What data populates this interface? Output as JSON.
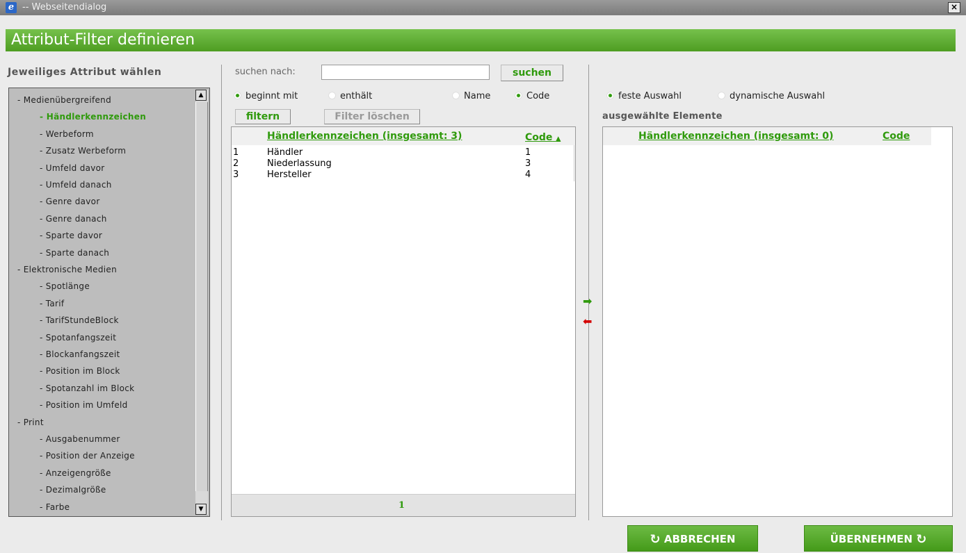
{
  "window": {
    "title": "-- Webseitendialog",
    "close_label": "×"
  },
  "header": {
    "title": "Attribut-Filter definieren"
  },
  "left": {
    "heading": "Jeweiliges Attribut wählen",
    "tree": [
      {
        "label": "Medienübergreifend",
        "level": 0,
        "active": false
      },
      {
        "label": "Händlerkennzeichen",
        "level": 1,
        "active": true
      },
      {
        "label": "Werbeform",
        "level": 1,
        "active": false
      },
      {
        "label": "Zusatz Werbeform",
        "level": 1,
        "active": false
      },
      {
        "label": "Umfeld davor",
        "level": 1,
        "active": false
      },
      {
        "label": "Umfeld danach",
        "level": 1,
        "active": false
      },
      {
        "label": "Genre davor",
        "level": 1,
        "active": false
      },
      {
        "label": "Genre danach",
        "level": 1,
        "active": false
      },
      {
        "label": "Sparte davor",
        "level": 1,
        "active": false
      },
      {
        "label": "Sparte danach",
        "level": 1,
        "active": false
      },
      {
        "label": "Elektronische Medien",
        "level": 0,
        "active": false
      },
      {
        "label": "Spotlänge",
        "level": 1,
        "active": false
      },
      {
        "label": "Tarif",
        "level": 1,
        "active": false
      },
      {
        "label": "TarifStundeBlock",
        "level": 1,
        "active": false
      },
      {
        "label": "Spotanfangszeit",
        "level": 1,
        "active": false
      },
      {
        "label": "Blockanfangszeit",
        "level": 1,
        "active": false
      },
      {
        "label": "Position im Block",
        "level": 1,
        "active": false
      },
      {
        "label": "Spotanzahl im Block",
        "level": 1,
        "active": false
      },
      {
        "label": "Position im Umfeld",
        "level": 1,
        "active": false
      },
      {
        "label": "Print",
        "level": 0,
        "active": false
      },
      {
        "label": "Ausgabenummer",
        "level": 1,
        "active": false
      },
      {
        "label": "Position der Anzeige",
        "level": 1,
        "active": false
      },
      {
        "label": "Anzeigengröße",
        "level": 1,
        "active": false
      },
      {
        "label": "Dezimalgröße",
        "level": 1,
        "active": false
      },
      {
        "label": "Farbe",
        "level": 1,
        "active": false
      }
    ]
  },
  "search": {
    "label": "suchen nach:",
    "value": "",
    "button": "suchen",
    "match_options": [
      {
        "label": "beginnt mit",
        "selected": true
      },
      {
        "label": "enthält",
        "selected": false
      }
    ],
    "field_options": [
      {
        "label": "Name",
        "selected": false
      },
      {
        "label": "Code",
        "selected": true
      }
    ],
    "filter_button": "filtern",
    "clear_button": "Filter löschen"
  },
  "available": {
    "col_name": "Händlerkennzeichen (insgesamt: 3)",
    "col_code": "Code",
    "sort_indicator": "▲",
    "rows": [
      {
        "index": "1",
        "name": "Händler",
        "code": "1"
      },
      {
        "index": "2",
        "name": "Niederlassung",
        "code": "3"
      },
      {
        "index": "3",
        "name": "Hersteller",
        "code": "4"
      }
    ],
    "page": "1"
  },
  "transfer": {
    "add_icon": "➡",
    "remove_icon": "⬅"
  },
  "selected": {
    "mode_options": [
      {
        "label": "feste Auswahl",
        "selected": true
      },
      {
        "label": "dynamische Auswahl",
        "selected": false
      }
    ],
    "heading": "ausgewählte Elemente",
    "col_name": "Händlerkennzeichen (insgesamt: 0)",
    "col_code": "Code"
  },
  "footer": {
    "cancel_label": "ABBRECHEN",
    "cancel_icon": "↻",
    "apply_label": "ÜBERNEHMEN",
    "apply_icon": "↻"
  },
  "colors": {
    "accent": "#2f9a0c",
    "header": "#5aa82e"
  }
}
